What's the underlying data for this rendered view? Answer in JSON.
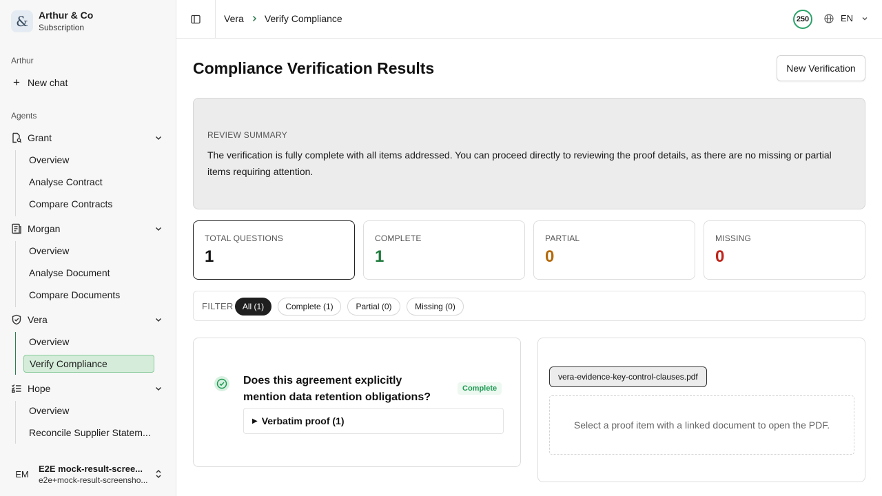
{
  "org": {
    "logo_glyph": "&",
    "name": "Arthur & Co",
    "plan": "Subscription"
  },
  "sidebar": {
    "section_user": "Arthur",
    "new_chat": "New chat",
    "section_agents": "Agents",
    "agents": [
      {
        "name": "Grant",
        "icon": "file-search-icon",
        "items": [
          "Overview",
          "Analyse Contract",
          "Compare Contracts"
        ]
      },
      {
        "name": "Morgan",
        "icon": "document-lines-icon",
        "items": [
          "Overview",
          "Analyse Document",
          "Compare Documents"
        ]
      },
      {
        "name": "Vera",
        "icon": "shield-check-icon",
        "items": [
          "Overview",
          "Verify Compliance"
        ],
        "selected": "Verify Compliance"
      },
      {
        "name": "Hope",
        "icon": "checklist-icon",
        "items": [
          "Overview",
          "Reconcile Supplier Statem..."
        ]
      }
    ],
    "user": {
      "initials": "EM",
      "name": "E2E mock-result-scree...",
      "email": "e2e+mock-result-screensho..."
    }
  },
  "header": {
    "breadcrumb": [
      "Vera",
      "Verify Compliance"
    ],
    "credits": "250",
    "language": "EN"
  },
  "main": {
    "title": "Compliance Verification Results",
    "new_verification": "New Verification",
    "review_label": "REVIEW SUMMARY",
    "review_text": "The verification is fully complete with all items addressed. You can proceed directly to reviewing the proof details, as there are no missing or partial items requiring attention.",
    "stats": [
      {
        "label": "TOTAL QUESTIONS",
        "value": "1",
        "color": "#111111"
      },
      {
        "label": "COMPLETE",
        "value": "1",
        "color": "#1e7a3c"
      },
      {
        "label": "PARTIAL",
        "value": "0",
        "color": "#b46a0a"
      },
      {
        "label": "MISSING",
        "value": "0",
        "color": "#c0241a"
      }
    ],
    "filter": {
      "label": "FILTER",
      "chips": [
        "All (1)",
        "Complete (1)",
        "Partial (0)",
        "Missing (0)"
      ],
      "active": "All (1)"
    },
    "question": {
      "text": "Does this agreement explicitly mention data retention obligations?",
      "status": "Complete",
      "proof_toggle": "Verbatim proof (1)"
    },
    "proof_panel": {
      "file": "vera-evidence-key-control-clauses.pdf",
      "empty_message": "Select a proof item with a linked document to open the PDF."
    }
  },
  "colors": {
    "accent_green": "#2aa36a",
    "selected_bg": "#d4ecd9",
    "complete": "#1e7a3c",
    "partial": "#b46a0a",
    "missing": "#c0241a"
  }
}
